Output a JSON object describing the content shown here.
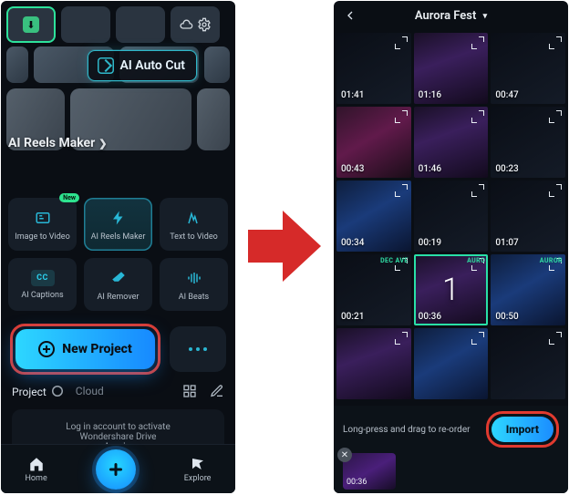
{
  "left": {
    "ai_auto_cut": "AI Auto Cut",
    "reels_title": "AI Reels Maker",
    "tools": [
      {
        "label": "Image to Video",
        "badge": "New"
      },
      {
        "label": "AI Reels Maker"
      },
      {
        "label": "Text  to Video"
      },
      {
        "label": "AI Captions"
      },
      {
        "label": "AI Remover"
      },
      {
        "label": "AI Beats"
      }
    ],
    "new_project": "New Project",
    "tab_project": "Project",
    "tab_cloud": "Cloud",
    "drive_line1": "Log in account to activate",
    "drive_line2": "Wondershare Drive",
    "drive_login": "Log in",
    "nav_home": "Home",
    "nav_explore": "Explore"
  },
  "right": {
    "album_title": "Aurora Fest",
    "clips": [
      {
        "dur": "01:41",
        "cls": "dark"
      },
      {
        "dur": "01:16",
        "cls": "concert"
      },
      {
        "dur": "00:47",
        "cls": "dark"
      },
      {
        "dur": "00:43",
        "cls": "pink"
      },
      {
        "dur": "01:46",
        "cls": "concert"
      },
      {
        "dur": "00:23",
        "cls": "dark"
      },
      {
        "dur": "00:34",
        "cls": "blue"
      },
      {
        "dur": "00:19",
        "cls": "dark"
      },
      {
        "dur": "01:07",
        "cls": "dark"
      },
      {
        "dur": "00:21",
        "cls": "dark",
        "brand": "DEC AVE"
      },
      {
        "dur": "00:36",
        "cls": "concert",
        "selected": true,
        "selnum": "1",
        "brand": "AURO"
      },
      {
        "dur": "00:50",
        "cls": "blue",
        "brand": "AUROR"
      },
      {
        "dur": "",
        "cls": "concert"
      },
      {
        "dur": "",
        "cls": "blue"
      },
      {
        "dur": "",
        "cls": "dark"
      }
    ],
    "footer_hint": "Long-press and drag to re-order",
    "import_label": "Import",
    "selected_dur": "00:36"
  }
}
